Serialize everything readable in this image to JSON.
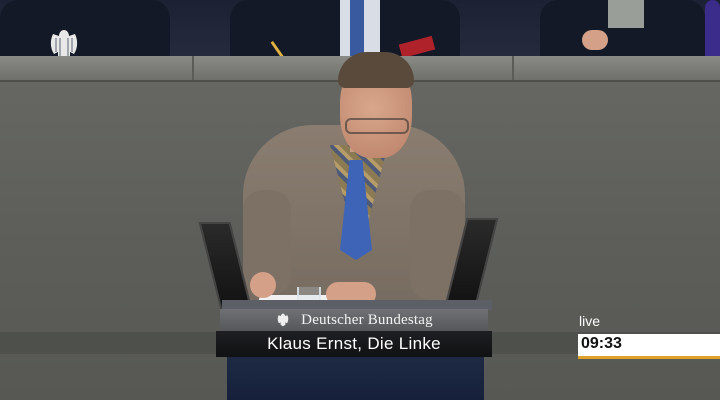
{
  "broadcast": {
    "organization": "Deutscher Bundestag",
    "speaker_caption": "Klaus Ernst, Die Linke",
    "live_label": "live",
    "clock": "09:33"
  },
  "icons": {
    "top_left": "federal-eagle-icon",
    "org_bar": "federal-eagle-icon"
  },
  "colors": {
    "clock_accent": "#e0a12b",
    "name_bar": "#141518",
    "org_bar": "#626468"
  }
}
